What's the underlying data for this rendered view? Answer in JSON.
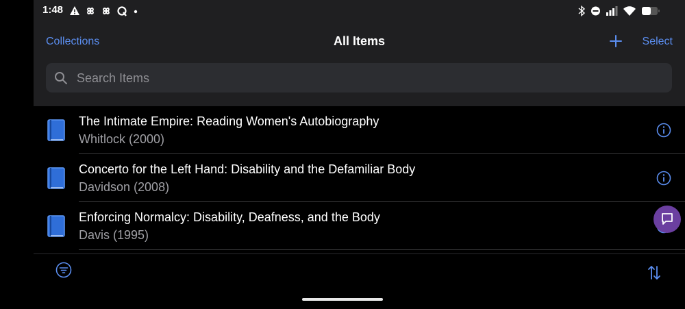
{
  "status_bar": {
    "time": "1:48",
    "left_icons": [
      "warning-icon",
      "pinwheel-icon",
      "pinwheel-icon",
      "quora-icon",
      "dot-icon"
    ],
    "right_icons": [
      "bluetooth-icon",
      "do-not-disturb-icon",
      "signal-icon",
      "wifi-icon",
      "battery-icon"
    ]
  },
  "nav": {
    "back_label": "Collections",
    "title": "All Items",
    "select_label": "Select"
  },
  "search": {
    "placeholder": "Search Items"
  },
  "items": [
    {
      "title": "The Intimate Empire: Reading Women's Autobiography",
      "subtitle": "Whitlock (2000)"
    },
    {
      "title": "Concerto for the Left Hand: Disability and the Defamiliar Body",
      "subtitle": "Davidson (2008)"
    },
    {
      "title": "Enforcing Normalcy: Disability, Deafness, and the Body",
      "subtitle": "Davis (1995)"
    }
  ],
  "colors": {
    "accent": "#5b8ef0",
    "book_icon": "#2f6ed8",
    "fab": "#6b3fa0",
    "header_bg": "#1f1f21",
    "search_bg": "#2c2d31"
  }
}
